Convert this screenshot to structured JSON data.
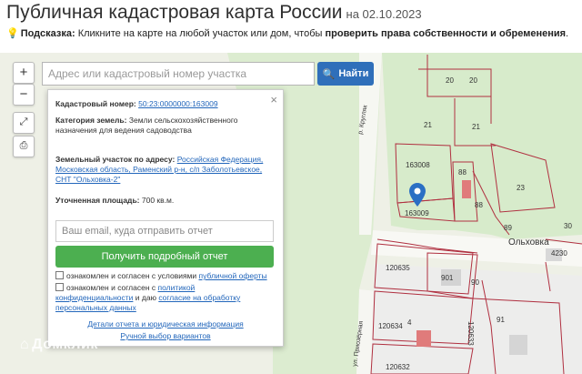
{
  "header": {
    "title": "Публичная кадастровая карта России",
    "date": "на 02.10.2023",
    "hint_label": "Подсказка:",
    "hint_text": " Кликните на карте на любой участок или дом, чтобы ",
    "hint_bold": "проверить права собственности и обременения",
    "hint_end": "."
  },
  "controls": {
    "zoom_in": "+",
    "zoom_out": "−"
  },
  "search": {
    "placeholder": "Адрес или кадастровый номер участка",
    "button_label": "Найти"
  },
  "popup": {
    "close": "×",
    "cadastral_label": "Кадастровый номер:",
    "cadastral_value": "50:23:0000000:163009",
    "category_label": "Категория земель:",
    "category_value": "Земли сельскохозяйственного назначения для ведения садоводства",
    "address_label": "Земельный участок по адресу:",
    "address_value": "Российская Федерация, Московская область, Раменский р-н, с/п Заболотьевское, СНТ \"Ольховка-2\"",
    "area_label": "Уточненная площадь:",
    "area_value": "700 кв.м.",
    "email_placeholder": "Ваш email, куда отправить отчет",
    "report_button": "Получить подробный отчет",
    "consent1_text": "ознакомлен и согласен с условиями ",
    "consent1_link": "публичной оферты",
    "consent2_text": "ознакомлен и согласен с ",
    "consent2_link": "политикой конфиденциальности",
    "consent2_mid": " и даю ",
    "consent2_link2": "согласие на обработку персональных данных",
    "details_link": "Детали отчета и юридическая информация",
    "manual_link": "Ручной выбор вариантов"
  },
  "map_labels": {
    "p20a": "20",
    "p20b": "20",
    "p21a": "21",
    "p21b": "21",
    "p163008": "163008",
    "p88a": "88",
    "p88b": "88",
    "p23": "23",
    "p163009": "163009",
    "p89": "89",
    "olkhovka": "Ольховка",
    "p30": "30",
    "p4230": "4230",
    "p120635": "120635",
    "p901": "901",
    "p90": "90",
    "p120634": "120634",
    "p120633": "120633",
    "p91": "91",
    "p120632": "120632",
    "p4": "4",
    "street1": "р. Кругляк",
    "street2": "ул. Приозёрная"
  },
  "watermark": "Домклик",
  "colors": {
    "accent_blue": "#2f6fba",
    "report_green": "#4caf50",
    "parcel_outline": "#b03040"
  }
}
